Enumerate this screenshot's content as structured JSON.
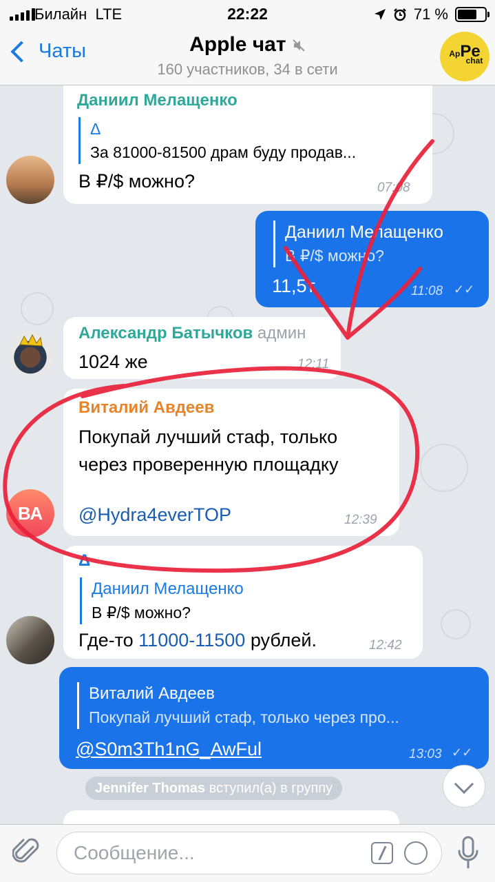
{
  "status_bar": {
    "carrier": "Билайн",
    "network": "LTE",
    "time": "22:22",
    "battery": "71 %",
    "battery_level": 0.71
  },
  "header": {
    "back_label": "Чаты",
    "title": "Apple чат",
    "subtitle": "160 участников, 34 в сети",
    "avatar_text_top": "Ap",
    "avatar_text_mid": "Pe",
    "avatar_text_bottom": "chat"
  },
  "messages": [
    {
      "sender": "Даниил Мелащенко",
      "reply_title": "Δ",
      "reply_text": "За 81000-81500 драм буду продав...",
      "text": "В ₽/$ можно?",
      "time": "07:08"
    },
    {
      "reply_title": "Даниил Мелащенко",
      "reply_text": "В ₽/$ можно?",
      "text": "11,5т",
      "time": "11:08"
    },
    {
      "sender": "Александр Батычков",
      "sender_role": "админ",
      "text": "1024 же",
      "time": "12:11"
    },
    {
      "sender": "Виталий Авдеев",
      "text_line1": "Покупай лучший стаф, только",
      "text_line2": "через проверенную площадку",
      "link": "@Hydra4everTOP",
      "time": "12:39",
      "avatar_initials": "ВА"
    },
    {
      "sender": "Δ",
      "reply_title": "Даниил Мелащенко",
      "reply_text": "В ₽/$ можно?",
      "text_before": "Где-то ",
      "text_highlight": "11000-11500",
      "text_after": " рублей.",
      "time": "12:42"
    },
    {
      "reply_title": "Виталий Авдеев",
      "reply_text": "Покупай лучший стаф, только через про...",
      "link": "@S0m3Th1nG_AwFul",
      "time": "13:03"
    }
  ],
  "service_message": {
    "name": "Jennifer Thomas",
    "text": "вступил(а) в группу"
  },
  "input": {
    "placeholder": "Сообщение..."
  },
  "colors": {
    "accent": "#1a7ae2",
    "outgoing_bubble": "#1a73e8",
    "annotation_red": "#e8213a",
    "sender_green": "#2fa89a",
    "sender_orange": "#e8832a"
  }
}
